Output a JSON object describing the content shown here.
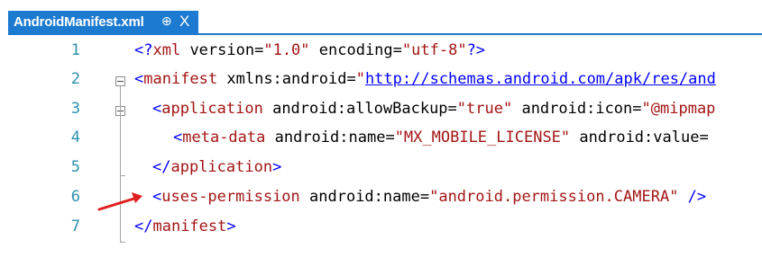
{
  "tab": {
    "title": "AndroidManifest.xml",
    "pin_glyph": "⊕",
    "close_glyph": "X"
  },
  "lines": [
    {
      "num": "1",
      "t1": "<?",
      "t2": "xml",
      "t3": " version",
      "t4": "=",
      "t5": "\"1.0\"",
      "t6": " encoding",
      "t7": "=",
      "t8": "\"utf-8\"",
      "t9": "?>"
    },
    {
      "num": "2",
      "t1": "<",
      "t2": "manifest",
      "t3": " xmlns:android",
      "t4": "=",
      "t5": "\"",
      "t6": "http://schemas.android.com/apk/res/and"
    },
    {
      "num": "3",
      "t1": "<",
      "t2": "application",
      "t3": " android:allowBackup",
      "t4": "=",
      "t5": "\"true\"",
      "t6": " android:icon",
      "t7": "=",
      "t8": "\"@mipmap"
    },
    {
      "num": "4",
      "t1": "<",
      "t2": "meta-data",
      "t3": " android:name",
      "t4": "=",
      "t5": "\"MX_MOBILE_LICENSE\"",
      "t6": " android:value",
      "t7": "="
    },
    {
      "num": "5",
      "t1": "</",
      "t2": "application",
      "t3": ">"
    },
    {
      "num": "6",
      "t1": "<",
      "t2": "uses-permission",
      "t3": " android:name",
      "t4": "=",
      "t5": "\"android.permission.CAMERA\"",
      "t6": " />"
    },
    {
      "num": "7",
      "t1": "</",
      "t2": "manifest",
      "t3": ">"
    }
  ],
  "colors": {
    "tab_accent": "#1c7ad1",
    "line_number": "#2b91af",
    "annotation_arrow": "#e02020"
  },
  "icons": [
    "pin-icon",
    "close-icon",
    "fold-toggle-icon",
    "red-arrow-annotation"
  ]
}
